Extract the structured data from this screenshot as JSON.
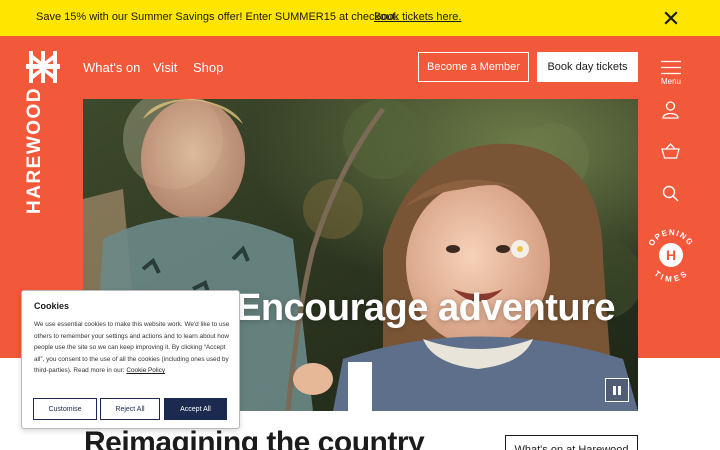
{
  "promo": {
    "text": "Save 15% with our Summer Savings offer! Enter SUMMER15 at checkout.",
    "link": "Book tickets here.",
    "close_icon": "close-icon"
  },
  "header": {
    "logo_icon": "harewood-logo",
    "nav": [
      "What's on",
      "Visit",
      "Shop"
    ],
    "member_button": "Become a Member",
    "book_button": "Book day tickets",
    "menu_label": "Menu"
  },
  "side_icons": [
    "menu-icon",
    "account-icon",
    "basket-icon",
    "search-icon",
    "opening-times-badge"
  ],
  "opening_badge": {
    "top_text": "OPENING",
    "bottom_text": "TIMES",
    "letter": "H"
  },
  "brand": {
    "vertical_name": "HAREWOOD"
  },
  "hero": {
    "headline": "Encourage adventure",
    "pause_icon": "pause-icon"
  },
  "content": {
    "heading": "Reimagining the country",
    "whats_on_button": "What's on at Harewood"
  },
  "cookie": {
    "title": "Cookies",
    "body": "We use essential cookies to make this website work. We'd like to use others to remember your settings and actions and to learn about how people use the site so we can keep improving it. By clicking “Accept all”, you consent to the use of all the cookies (including ones used by third-parties). Read more in our:",
    "policy_link": "Cookie Policy",
    "customise": "Customise",
    "reject": "Reject All",
    "accept": "Accept All"
  },
  "colors": {
    "banner": "#ffe600",
    "brand_orange": "#f2593a",
    "cookie_navy": "#1c2a4f"
  }
}
